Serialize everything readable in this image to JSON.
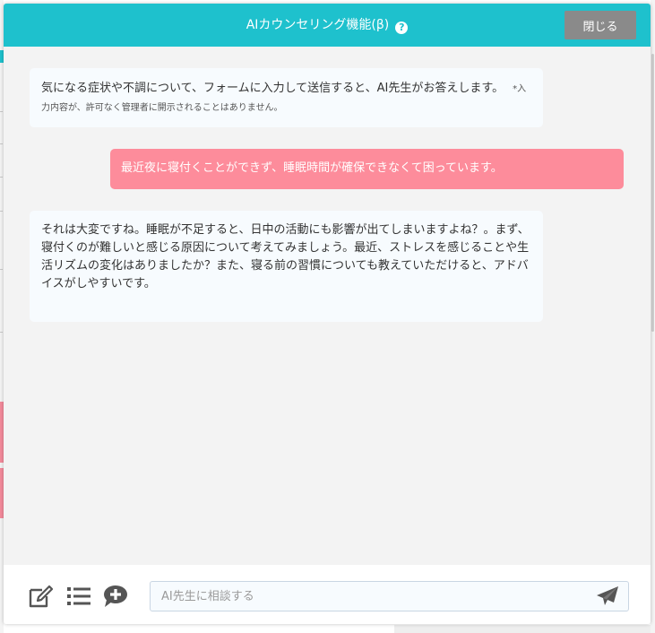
{
  "dialog": {
    "title": "AIカウンセリング機能(β)",
    "help_icon": "question-circle-icon",
    "close_label": "閉じる"
  },
  "messages": [
    {
      "role": "ai",
      "text": "気になる症状や不調について、フォームに入力して送信すると、AI先生がお答えします。",
      "note": "*入力内容が、許可なく管理者に開示されることはありません。"
    },
    {
      "role": "user",
      "text": "最近夜に寝付くことができず、睡眠時間が確保できなくて困っています。"
    },
    {
      "role": "ai",
      "text": "それは大変ですね。睡眠が不足すると、日中の活動にも影響が出てしまいますよね？。まず、寝付くのが難しいと感じる原因について考えてみましょう。最近、ストレスを感じることや生活リズムの変化はありましたか？また、寝る前の習慣についても教えていただけると、アドバイスがしやすいです。"
    }
  ],
  "footer": {
    "icons": [
      "edit-icon",
      "list-icon",
      "chat-add-icon"
    ],
    "input_placeholder": "AI先生に相談する",
    "input_value": "",
    "send_icon": "paper-plane-icon"
  },
  "colors": {
    "header": "#1ec1cd",
    "user_bubble": "#fd8c9b",
    "ai_bubble": "#f7fbfe",
    "close_button": "#8a8a8a",
    "background": "#f3f3f3"
  }
}
